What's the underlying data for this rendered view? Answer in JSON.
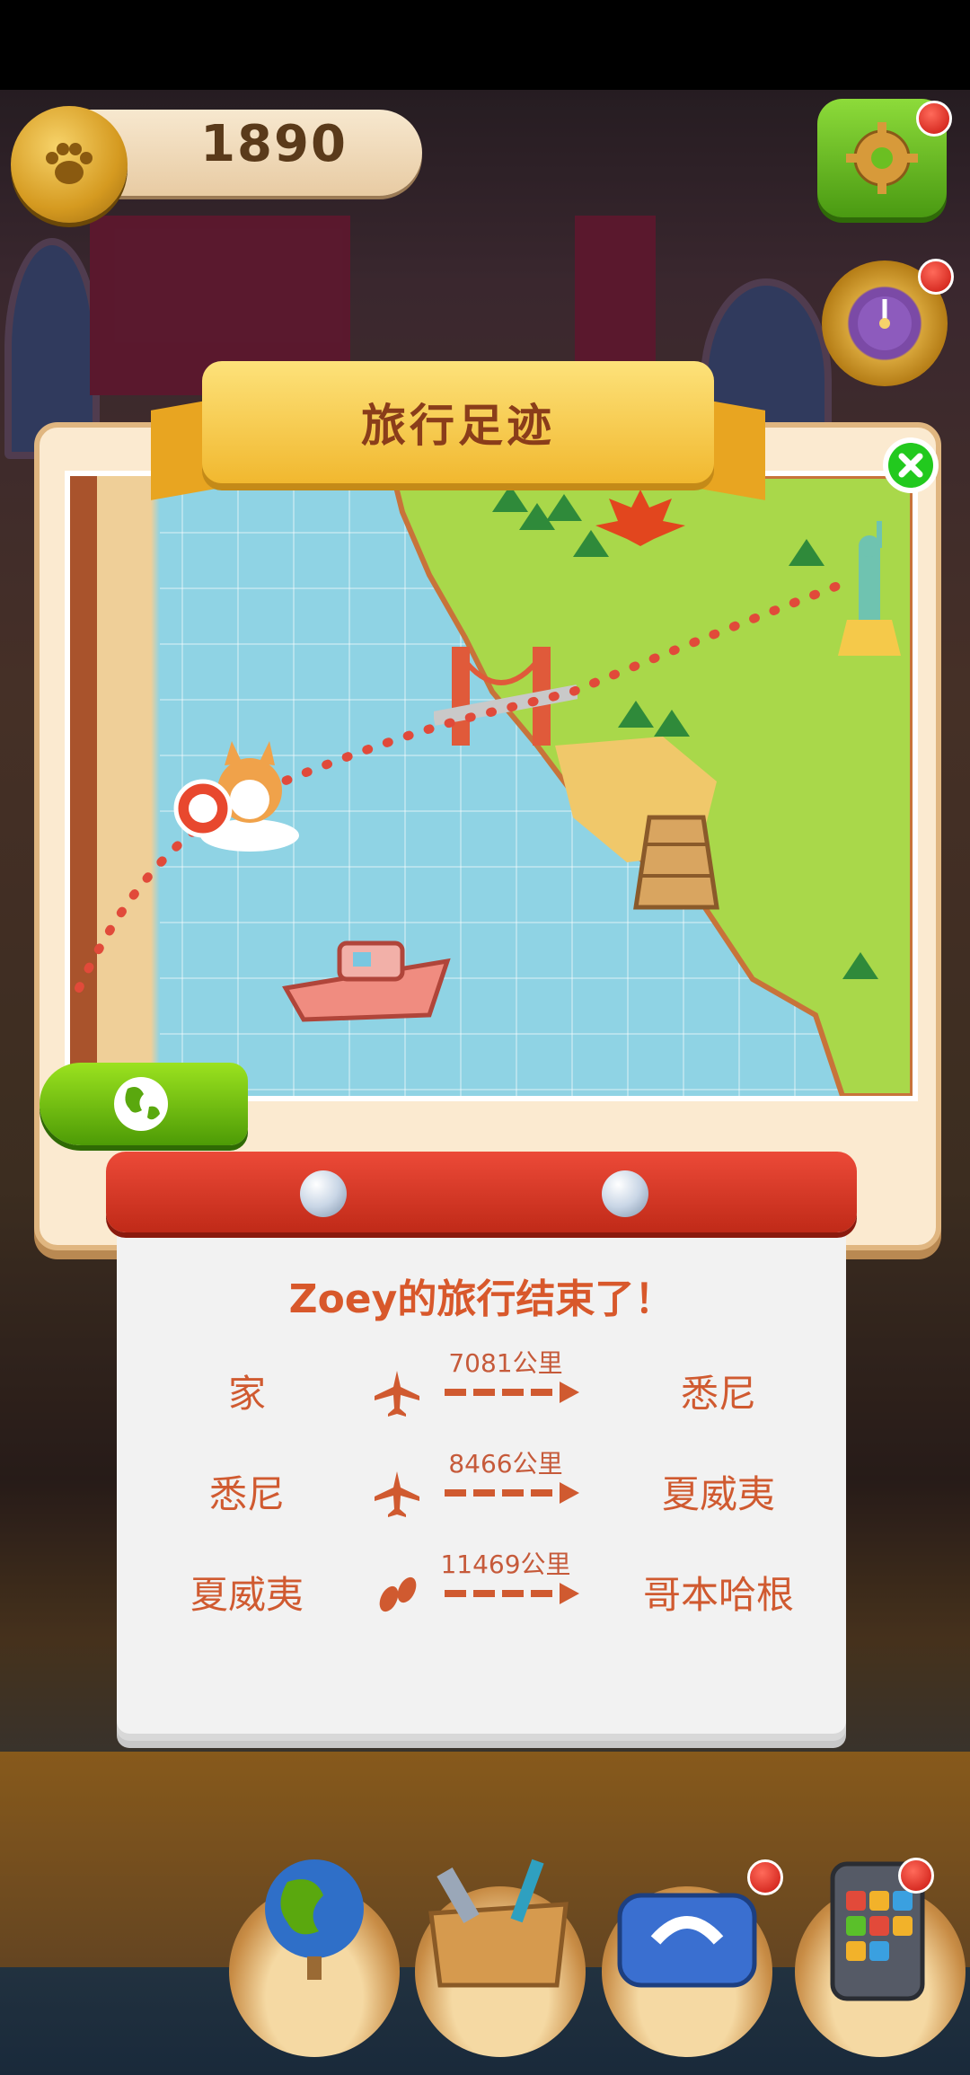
{
  "hud": {
    "coins": "1890",
    "coin_icon": "paw-coin-icon",
    "settings_icon": "gear-icon",
    "wheel_icon": "lucky-wheel-icon"
  },
  "panel": {
    "title": "旅行足迹",
    "close_icon": "close-icon",
    "globe_icon": "globe-icon"
  },
  "summary": {
    "heading": "Zoey的旅行结束了！",
    "routes": [
      {
        "from": "家",
        "mode": "plane",
        "distance": "7081公里",
        "to": "悉尼"
      },
      {
        "from": "悉尼",
        "mode": "plane",
        "distance": "8466公里",
        "to": "夏威夷"
      },
      {
        "from": "夏威夷",
        "mode": "footprints",
        "distance": "11469公里",
        "to": "哥本哈根"
      }
    ]
  },
  "dock": {
    "items": [
      "globe-icon",
      "toolbox-icon",
      "telephone-icon",
      "phone-device-icon"
    ]
  },
  "colors": {
    "route_text": "#d05a30",
    "accent_green": "#4d9b06",
    "banner_gold": "#f1b82f"
  }
}
